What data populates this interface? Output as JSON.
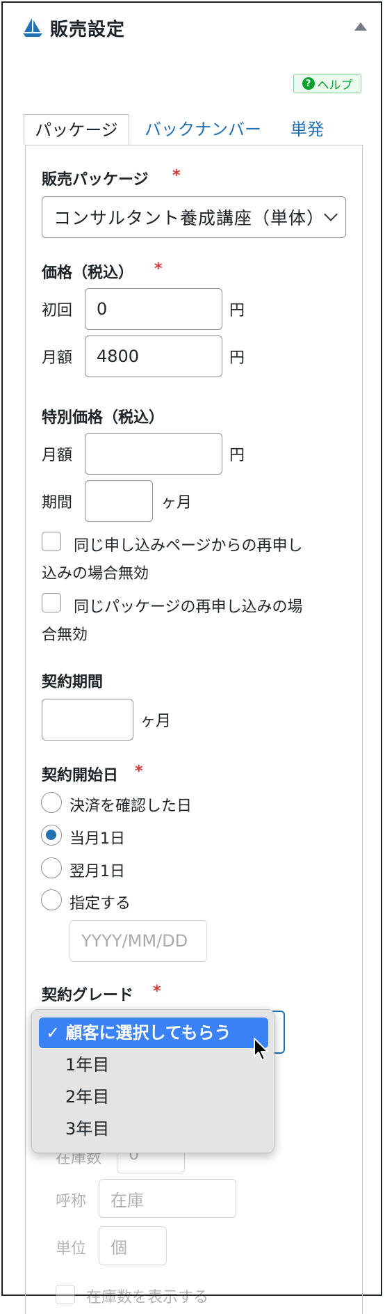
{
  "panel": {
    "title": "販売設定",
    "help_label": "ヘルプ",
    "help_icon": "?"
  },
  "tabs": [
    {
      "label": "パッケージ",
      "active": true
    },
    {
      "label": "バックナンバー",
      "active": false
    },
    {
      "label": "単発",
      "active": false
    }
  ],
  "package": {
    "label": "販売パッケージ",
    "required": "*",
    "selected": "コンサルタント養成講座（単体）"
  },
  "price": {
    "label": "価格（税込）",
    "required": "*",
    "initial_label": "初回",
    "initial_value": "0",
    "monthly_label": "月額",
    "monthly_value": "4800",
    "unit": "円"
  },
  "special_price": {
    "label": "特別価格（税込）",
    "monthly_label": "月額",
    "monthly_value": "",
    "unit": "円",
    "period_label": "期間",
    "period_value": "",
    "period_unit": "ヶ月",
    "checkbox1_line1": "同じ申し込みページからの再申し",
    "checkbox1_line2": "込みの場合無効",
    "checkbox2_line1": "同じパッケージの再申し込みの場",
    "checkbox2_line2": "合無効"
  },
  "contract_period": {
    "label": "契約期間",
    "value": "",
    "unit": "ヶ月"
  },
  "start_date": {
    "label": "契約開始日",
    "required": "*",
    "options": [
      "決済を確認した日",
      "当月1日",
      "翌月1日",
      "指定する"
    ],
    "selected_index": 1,
    "date_placeholder": "YYYY/MM/DD"
  },
  "grade": {
    "label": "契約グレード",
    "required": "*",
    "options": [
      "✓ 顧客に選択してもらう",
      "1年目",
      "2年目",
      "3年目"
    ],
    "selected_index": 0
  },
  "stock": {
    "count_label": "在庫数",
    "count_value": "0",
    "name_label": "呼称",
    "name_value": "在庫",
    "unit_label": "単位",
    "unit_value": "個",
    "show_label": "在庫数を表示する"
  },
  "colors": {
    "accent": "#2271b1",
    "required": "#d63638",
    "help_green": "#00a32a",
    "highlight": "#3b82f6"
  }
}
